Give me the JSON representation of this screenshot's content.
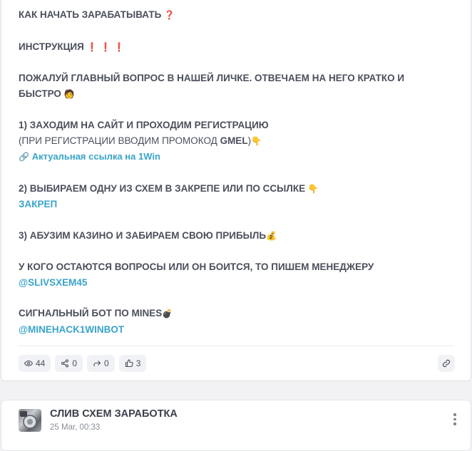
{
  "post": {
    "heading": "КАК НАЧАТЬ ЗАРАБАТЫВАТЬ",
    "heading_emoji": "❓",
    "instruction": "ИНСТРУКЦИЯ",
    "instruction_emoji": "❗ ❗ ❗",
    "intro_line1": "ПОЖАЛУЙ ГЛАВНЫЙ ВОПРОС В НАШЕЙ ЛИЧКЕ. ОТВЕЧАЕМ НА НЕГО КРАТКО И",
    "intro_line2": "БЫСТРО",
    "intro_emoji": "🧑",
    "step1": "1) ЗАХОДИМ НА САЙТ И ПРОХОДИМ РЕГИСТРАЦИЮ",
    "step1_note_pre": "(ПРИ РЕГИСТРАЦИИ ВВОДИМ ПРОМОКОД ",
    "promo_code": "GMEL",
    "step1_note_post": ")",
    "point_emoji": "👇",
    "link_emoji": "🔗",
    "site_link": "Актуальная ссылка на 1Win",
    "step2": "2) ВЫБИРАЕМ ОДНУ ИЗ СХЕМ В ЗАКРЕПЕ ИЛИ ПО ССЫЛКЕ",
    "pin_link": "ЗАКРЕП",
    "step3": "3) АБУЗИМ КАЗИНО И ЗАБИРАЕМ СВОЮ ПРИБЫЛЬ",
    "money_emoji": "💰",
    "manager_text": "У КОГО ОСТАЮТСЯ ВОПРОСЫ ИЛИ ОН БОИТСЯ, ТО ПИШЕМ МЕНЕДЖЕРУ",
    "manager_link": "@SLIVSXEM45",
    "bot_text": "СИГНАЛЬНЫЙ БОТ ПО MINES",
    "bomb_emoji": "💣",
    "bot_link": "@MINEHACK1WINBOT"
  },
  "stats": {
    "views": "44",
    "shares": "0",
    "forwards": "0",
    "likes": "3"
  },
  "next_post": {
    "channel_title": "СЛИВ СХЕМ ЗАРАБОТКА",
    "date": "25 Mar, 00:33"
  },
  "colors": {
    "link": "#3aa4c9",
    "text": "#4b4f5c",
    "accent_red": "#e0245e"
  },
  "icons": {
    "views": "eye-icon",
    "shares": "share-icon",
    "forwards": "forward-icon",
    "likes": "thumbs-up-icon",
    "copy_link": "link-icon",
    "menu": "kebab-menu-icon"
  }
}
